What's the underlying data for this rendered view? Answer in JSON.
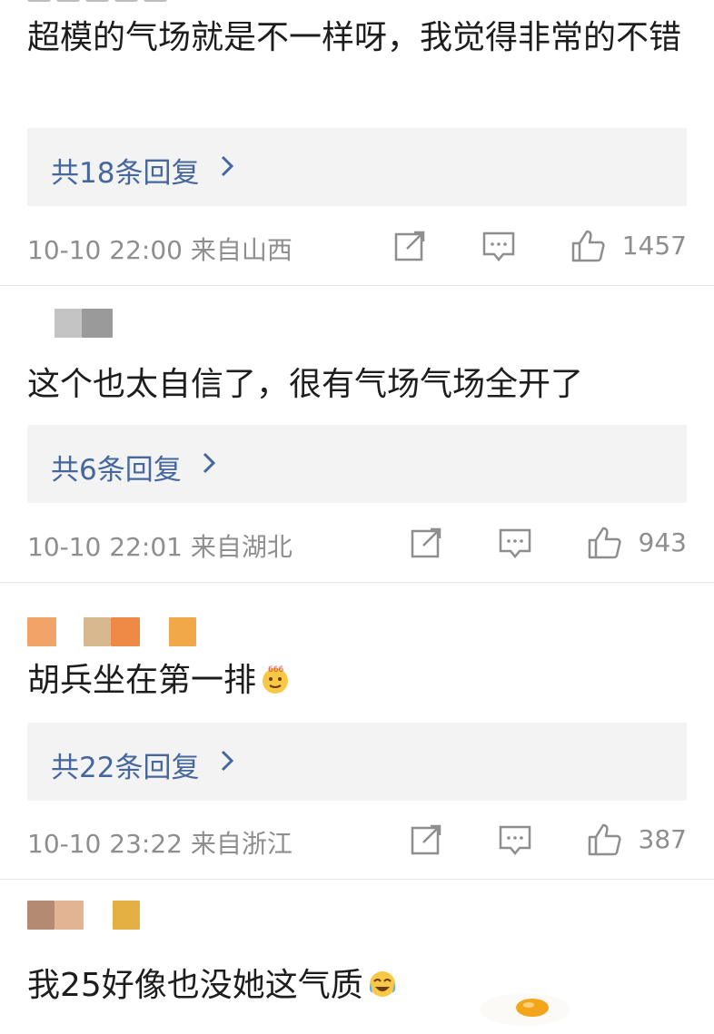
{
  "top_fragment": "",
  "comments": [
    {
      "text": "超模的气场就是不一样呀，我觉得非常的不错",
      "replies": "共18条回复",
      "time": "10-10 22:00",
      "location": "来自山西",
      "likes": "1457"
    },
    {
      "text": "这个也太自信了，很有气场气场全开了",
      "replies": "共6条回复",
      "time": "10-10 22:01",
      "location": "来自湖北",
      "likes": "943"
    },
    {
      "text": "胡兵坐在第一排",
      "replies": "共22条回复",
      "time": "10-10 23:22",
      "location": "来自浙江",
      "likes": "387"
    },
    {
      "text": "我25好像也没她这气质"
    }
  ],
  "icons": {
    "share": "share-icon",
    "comment": "comment-icon",
    "like": "thumbs-up-icon",
    "chevron": "chevron-right-icon",
    "emoji_666": "emoji-666-icon",
    "emoji_laugh_cry": "laugh-cry-emoji-icon"
  },
  "colors": {
    "link": "#46679d",
    "meta": "#8e8e8e",
    "reply_bg": "#f3f3f3"
  }
}
